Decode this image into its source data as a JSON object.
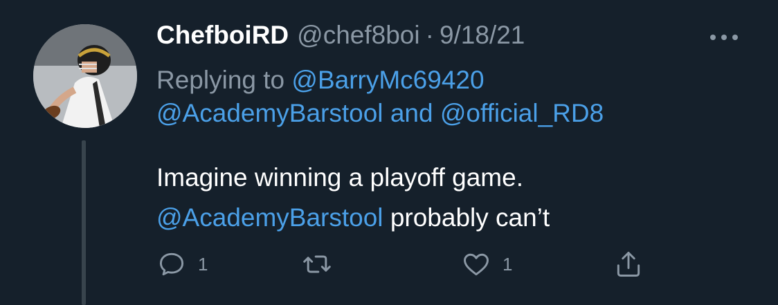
{
  "tweet": {
    "display_name": "ChefboiRD",
    "handle": "@chef8boi",
    "separator": "·",
    "date": "9/18/21",
    "replying_to_label": "Replying to",
    "reply_user_1": "@BarryMc69420",
    "reply_user_2": "@AcademyBarstool",
    "reply_joiner": "and",
    "reply_user_3": "@official_RD8",
    "text_line_1": "Imagine winning a playoff game.",
    "text_mention": "@AcademyBarstool",
    "text_rest": "probably can’t"
  },
  "actions": {
    "reply_count": "1",
    "retweet_count": "",
    "like_count": "1"
  },
  "icons": {
    "avatar": "football-player-avatar",
    "more": "more-icon",
    "reply": "reply-icon",
    "retweet": "retweet-icon",
    "like": "heart-icon",
    "share": "share-icon"
  },
  "colors": {
    "background": "#15202b",
    "link": "#4ba0e8",
    "muted": "#8b98a5",
    "text": "#ffffff",
    "thread_line": "#38444d"
  }
}
